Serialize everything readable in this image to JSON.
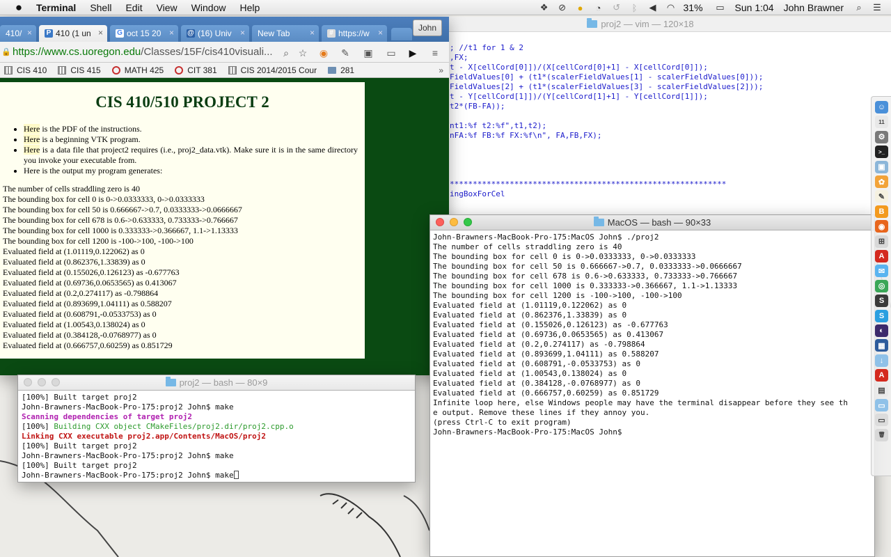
{
  "menubar": {
    "app_name": "Terminal",
    "menus": [
      "Shell",
      "Edit",
      "View",
      "Window",
      "Help"
    ],
    "battery": "31%",
    "clock": "Sun 1:04",
    "user": "John Brawner",
    "status_icons": [
      "dropbox-icon",
      "copy-icon",
      "moon-icon",
      "gauge-icon",
      "time-machine-icon",
      "bluetooth-icon",
      "volume-icon",
      "wifi-icon",
      "battery-icon"
    ]
  },
  "vim": {
    "title": "proj2 — vim — 120×18",
    "lines": [
      "; //t1 for 1 & 2",
      ",FX;",
      "t - X[cellCord[0]])/(X[cellCord[0]+1] - X[cellCord[0]]);",
      "FieldValues[0] + (t1*(scalerFieldValues[1] - scalerFieldValues[0]));",
      "FieldValues[2] + (t1*(scalerFieldValues[3] - scalerFieldValues[2]));",
      "t - Y[cellCord[1]])/(Y[cellCord[1]+1] - Y[cellCord[1]]);",
      "t2*(FB-FA));",
      "",
      "nt1:%f t2:%f\",t1,t2);",
      "nFA:%f FB:%f FX:%f\\n\", FA,FB,FX);",
      "",
      "",
      "",
      "",
      "************************************************************",
      "ingBoxForCel"
    ]
  },
  "chrome": {
    "tabs": [
      {
        "label": "410/",
        "fav": ""
      },
      {
        "label": "410 (1 un",
        "fav": "P"
      },
      {
        "label": "oct 15 20",
        "fav": "G"
      },
      {
        "label": "(16) Univ",
        "fav": "@"
      },
      {
        "label": "New Tab",
        "fav": ""
      },
      {
        "label": "https://w",
        "fav": "#"
      }
    ],
    "profile": "John",
    "url_scheme_host": "https://www.cs.uoregon.edu",
    "url_path": "/Classes/15F/cis410visuali...",
    "bookmarks": [
      {
        "label": "CIS 410",
        "kind": "grid"
      },
      {
        "label": "CIS 415",
        "kind": "grid"
      },
      {
        "label": "MATH 425",
        "kind": "ring"
      },
      {
        "label": "CIT 381",
        "kind": "ring"
      },
      {
        "label": "CIS 2014/2015 Cour",
        "kind": "grid"
      },
      {
        "label": "281",
        "kind": "folder"
      }
    ],
    "overflow": "»"
  },
  "page": {
    "title": "CIS 410/510 PROJECT 2",
    "bullets": [
      {
        "link": "Here",
        "rest": " is the PDF of the instructions."
      },
      {
        "link": "Here",
        "rest": " is a beginning VTK program."
      },
      {
        "link": "Here",
        "rest": " is a data file that project2 requires (i.e., proj2_data.vtk). Make sure it is in the same directory you invoke your executable from."
      },
      {
        "link": "",
        "rest": "Here is the output my program generates:"
      }
    ],
    "output": [
      "The number of cells straddling zero is 40",
      "The bounding box for cell 0 is 0->0.0333333, 0->0.0333333",
      "The bounding box for cell 50 is 0.666667->0.7, 0.0333333->0.0666667",
      "The bounding box for cell 678 is 0.6->0.633333, 0.733333->0.766667",
      "The bounding box for cell 1000 is 0.333333->0.366667, 1.1->1.13333",
      "The bounding box for cell 1200 is -100->100, -100->100",
      "Evaluated field at (1.01119,0.122062) as 0",
      "Evaluated field at (0.862376,1.33839) as 0",
      "Evaluated field at (0.155026,0.126123) as -0.677763",
      "Evaluated field at (0.69736,0.0653565) as 0.413067",
      "Evaluated field at (0.2,0.274117) as -0.798864",
      "Evaluated field at (0.893699,1.04111) as 0.588207",
      "Evaluated field at (0.608791,-0.0533753) as 0",
      "Evaluated field at (1.00543,0.138024) as 0",
      "Evaluated field at (0.384128,-0.0768977) as 0",
      "Evaluated field at (0.666757,0.60259) as 0.851729"
    ]
  },
  "term_small": {
    "title": "proj2 — bash — 80×9",
    "lines": [
      {
        "text": "[100%] Built target proj2",
        "style": ""
      },
      {
        "text": "John-Brawners-MacBook-Pro-175:proj2 John$ make",
        "style": ""
      },
      {
        "text": "Scanning dependencies of target proj2",
        "style": "t-magenta"
      },
      {
        "text": "[100%] ",
        "style": "",
        "extra": "Building CXX object CMakeFiles/proj2.dir/proj2.cpp.o",
        "extra_style": "t-green"
      },
      {
        "text": "Linking CXX executable proj2.app/Contents/MacOS/proj2",
        "style": "t-red"
      },
      {
        "text": "[100%] Built target proj2",
        "style": ""
      },
      {
        "text": "John-Brawners-MacBook-Pro-175:proj2 John$ make",
        "style": ""
      },
      {
        "text": "[100%] Built target proj2",
        "style": ""
      }
    ],
    "prompt": "John-Brawners-MacBook-Pro-175:proj2 John$ make"
  },
  "term_big": {
    "title": "MacOS — bash — 90×33",
    "lines": [
      "John-Brawners-MacBook-Pro-175:MacOS John$ ./proj2",
      "The number of cells straddling zero is 40",
      "The bounding box for cell 0 is 0->0.0333333, 0->0.0333333",
      "The bounding box for cell 50 is 0.666667->0.7, 0.0333333->0.0666667",
      "The bounding box for cell 678 is 0.6->0.633333, 0.733333->0.766667",
      "The bounding box for cell 1000 is 0.333333->0.366667, 1.1->1.13333",
      "The bounding box for cell 1200 is -100->100, -100->100",
      "Evaluated field at (1.01119,0.122062) as 0",
      "Evaluated field at (0.862376,1.33839) as 0",
      "Evaluated field at (0.155026,0.126123) as -0.677763",
      "Evaluated field at (0.69736,0.0653565) as 0.413067",
      "Evaluated field at (0.2,0.274117) as -0.798864",
      "Evaluated field at (0.893699,1.04111) as 0.588207",
      "Evaluated field at (0.608791,-0.0533753) as 0",
      "Evaluated field at (1.00543,0.138024) as 0",
      "Evaluated field at (0.384128,-0.0768977) as 0",
      "Evaluated field at (0.666757,0.60259) as 0.851729",
      "Infinite loop here, else Windows people may have the terminal disappear before they see th",
      "e output. Remove these lines if they annoy you.",
      "(press Ctrl-C to exit program)",
      "John-Brawners-MacBook-Pro-175:MacOS John$"
    ]
  },
  "dock": {
    "items": [
      {
        "name": "finder-icon",
        "color": "#4a90d9",
        "glyph": "☺"
      },
      {
        "name": "calendar-icon",
        "color": "#e8e8e8",
        "glyph": "11"
      },
      {
        "name": "system-preferences-icon",
        "color": "#7a7a7a",
        "glyph": "⚙"
      },
      {
        "name": "terminal-icon",
        "color": "#222222",
        "glyph": ">_"
      },
      {
        "name": "preview-icon",
        "color": "#8cb6d9",
        "glyph": "▣"
      },
      {
        "name": "photos-icon",
        "color": "#f2a33a",
        "glyph": "✿"
      },
      {
        "name": "textedit-icon",
        "color": "#f5f1e0",
        "glyph": "✎"
      },
      {
        "name": "ibooks-icon",
        "color": "#f39a1e",
        "glyph": "B"
      },
      {
        "name": "firefox-icon",
        "color": "#e8661d",
        "glyph": "◉"
      },
      {
        "name": "launchpad-icon",
        "color": "#d8d8d8",
        "glyph": "⊞"
      },
      {
        "name": "acrobat-icon",
        "color": "#d42a1f",
        "glyph": "A"
      },
      {
        "name": "messages-icon",
        "color": "#5ab4f0",
        "glyph": "✉"
      },
      {
        "name": "chrome-icon",
        "color": "#3aa757",
        "glyph": "◎"
      },
      {
        "name": "sublime-icon",
        "color": "#3a3a3a",
        "glyph": "S"
      },
      {
        "name": "skype-icon",
        "color": "#2b9fe0",
        "glyph": "S"
      },
      {
        "name": "eclipse-icon",
        "color": "#3c2a6b",
        "glyph": "◐"
      },
      {
        "name": "virtualbox-icon",
        "color": "#2d5b9c",
        "glyph": "▦"
      },
      {
        "name": "downloads-folder-icon",
        "color": "#8fc1e8",
        "glyph": "↓"
      },
      {
        "name": "pdf-icon",
        "color": "#d42a1f",
        "glyph": "A"
      },
      {
        "name": "documents-icon",
        "color": "#eaeaea",
        "glyph": "▤"
      },
      {
        "name": "folder-icon",
        "color": "#8fc1e8",
        "glyph": "▭"
      },
      {
        "name": "disk-icon",
        "color": "#dcdcdc",
        "glyph": "▭"
      },
      {
        "name": "trash-icon",
        "color": "#d8d8d8",
        "glyph": "🗑"
      }
    ]
  }
}
